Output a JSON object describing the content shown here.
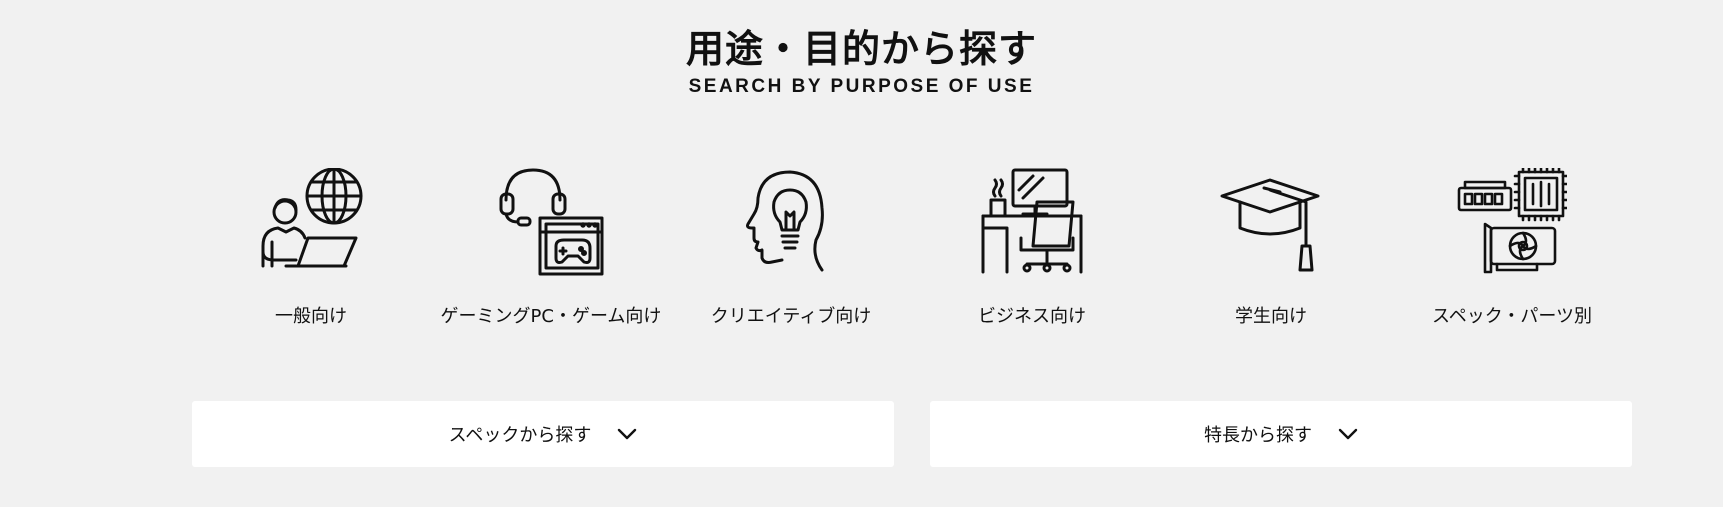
{
  "section": {
    "title": "用途・目的から探す",
    "subtitle": "SEARCH BY PURPOSE OF USE"
  },
  "categories": [
    {
      "label": "一般向け",
      "icon": "person-laptop-globe-icon"
    },
    {
      "label": "ゲーミングPC・ゲーム向け",
      "icon": "headset-gamepad-icon"
    },
    {
      "label": "クリエイティブ向け",
      "icon": "head-lightbulb-icon"
    },
    {
      "label": "ビジネス向け",
      "icon": "office-desk-chair-icon"
    },
    {
      "label": "学生向け",
      "icon": "graduation-cap-icon"
    },
    {
      "label": "スペック・パーツ別",
      "icon": "pc-parts-icon"
    }
  ],
  "buttons": {
    "spec": "スペックから探す",
    "feature": "特長から探す"
  }
}
